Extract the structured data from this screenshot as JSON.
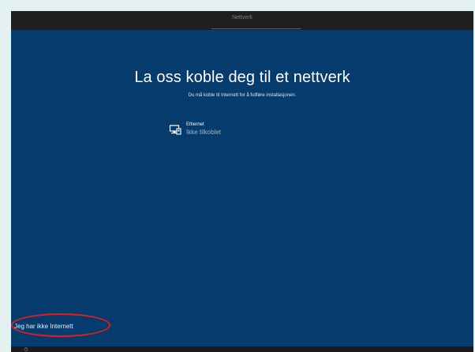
{
  "topbar": {
    "section_label": "Nettverk"
  },
  "main": {
    "title": "La oss koble deg til et nettverk",
    "subtitle": "Du må koble til Internett for å fullføre installasjonen."
  },
  "networks": [
    {
      "name": "Ethernet",
      "status": "Ikke tilkoblet",
      "icon": "ethernet-icon"
    }
  ],
  "actions": {
    "no_internet_label": "Jeg har ikke Internett"
  },
  "colors": {
    "background": "#053b6d",
    "highlight_ring": "#e01f1f",
    "topbar": "#1f1f1f"
  },
  "icons": {
    "ease_of_access": "accessibility-icon"
  }
}
